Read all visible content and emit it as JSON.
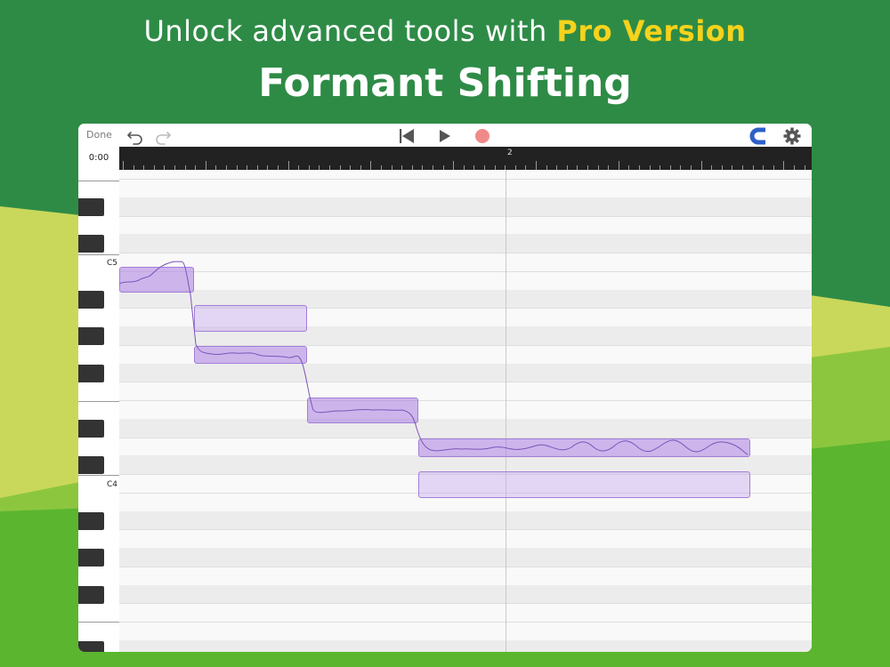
{
  "promo": {
    "line1_prefix": "Unlock advanced tools with ",
    "line1_highlight": "Pro Version",
    "title": "Formant Shifting"
  },
  "colors": {
    "bg_top": "#2e8b46",
    "bg_bottom": "#5bb52e",
    "highlight": "#f6d31c",
    "note_fill": "#b48de8",
    "note_border": "#a27fd8",
    "record": "#f08a8a",
    "magnet": "#2e5fc8"
  },
  "toolbar": {
    "done_label": "Done",
    "undo_icon": "undo-icon",
    "redo_icon": "redo-icon",
    "rewind_icon": "skip-to-start-icon",
    "play_icon": "play-icon",
    "record_icon": "record-icon",
    "snap_icon": "magnet-icon",
    "settings_icon": "gear-icon"
  },
  "timeline": {
    "position": "0:00",
    "bar_marker": "2"
  },
  "keyboard": {
    "labels": [
      "C5",
      "C4"
    ]
  },
  "tools": [
    {
      "name": "move-tool",
      "icon": "move-arrows-icon",
      "active": false
    },
    {
      "name": "split-tool",
      "icon": "scissors-icon",
      "active": false
    },
    {
      "name": "vibrato-tool",
      "icon": "wave-arrows-icon",
      "active": false
    },
    {
      "name": "pitch-drift-tool",
      "icon": "pitch-curve-icon",
      "active": false
    },
    {
      "name": "formant-tool",
      "icon": "formant-peaks-icon",
      "active": true
    }
  ]
}
